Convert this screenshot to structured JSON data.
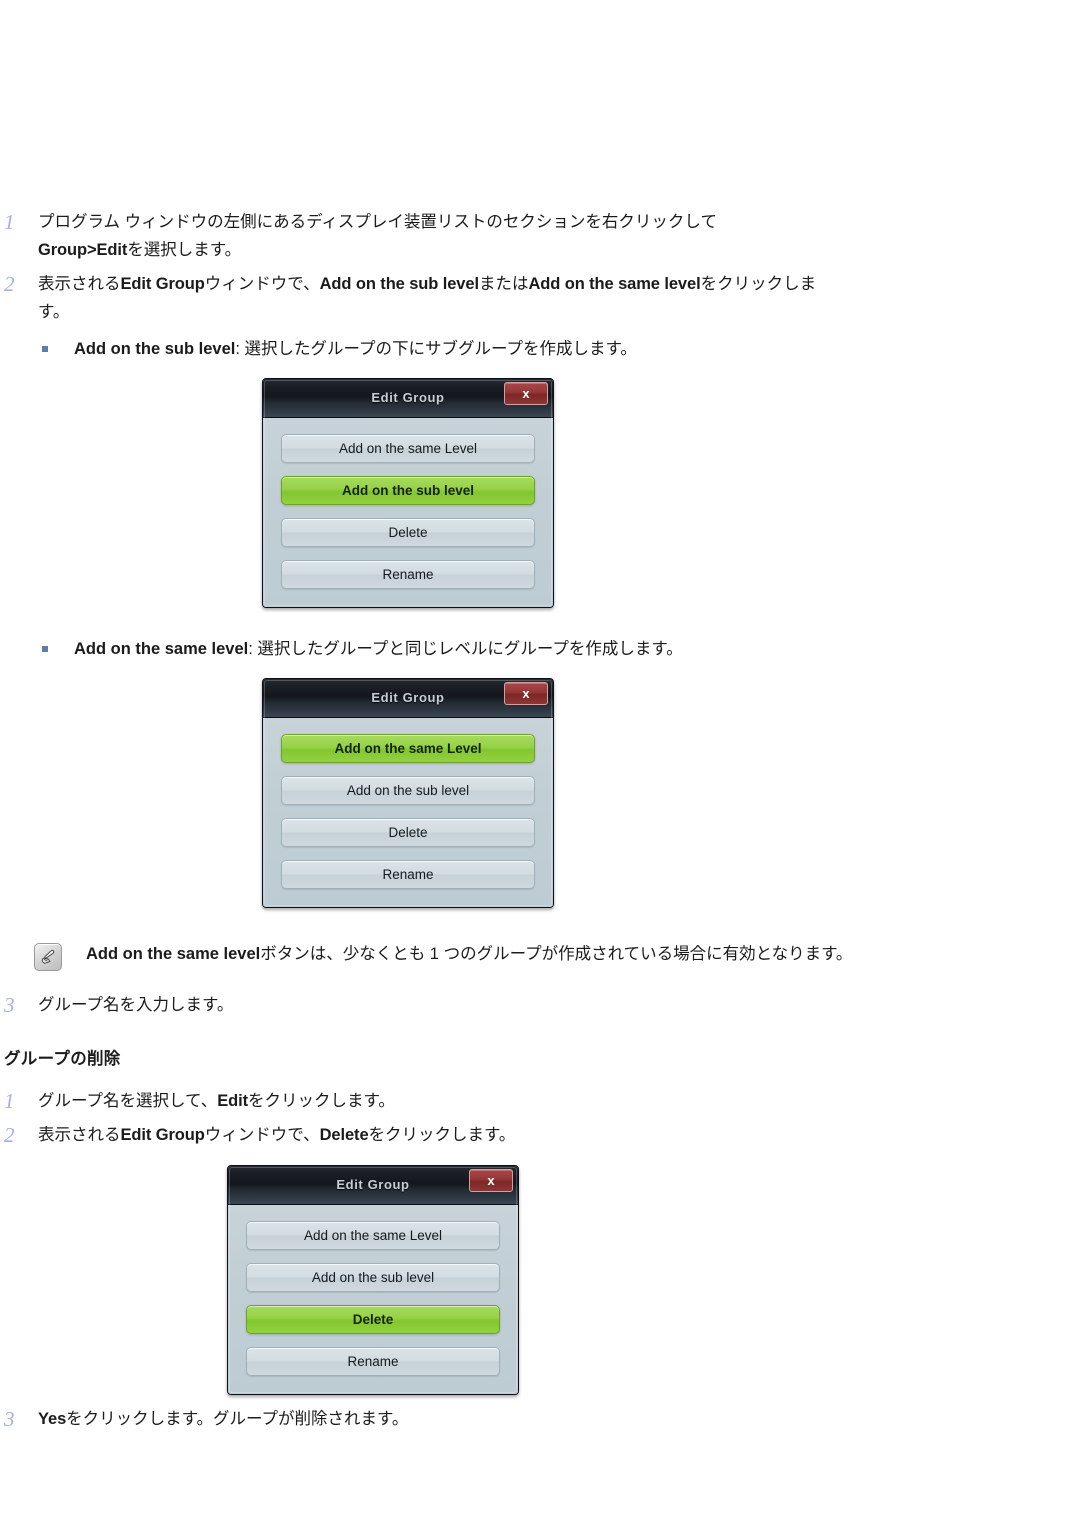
{
  "steps_create": [
    {
      "num": "1",
      "line1_pre": "プログラム ウィンドウの左側にあるディスプレイ装置リストのセクションを右クリックして",
      "line2_bold": "Group>Edit",
      "line2_post": "を選択します。"
    },
    {
      "num": "2",
      "pre": "表示される",
      "b1": "Edit Group",
      "mid1": "ウィンドウで、",
      "b2": "Add on the sub level",
      "mid2": "または",
      "b3": "Add on the same level",
      "post": "をクリックします。"
    },
    {
      "num": "3",
      "text": "グループ名を入力します。"
    }
  ],
  "bullets": [
    {
      "label": "Add on the sub level",
      "desc": ": 選択したグループの下にサブグループを作成します。"
    },
    {
      "label": "Add on the same level",
      "desc": ": 選択したグループと同じレベルにグループを作成します。"
    }
  ],
  "note": {
    "icon": "note-pencil-icon",
    "bold": "Add on the same level",
    "text": "ボタンは、少なくとも 1 つのグループが作成されている場合に有効となります。"
  },
  "section_delete": {
    "heading": "グループの削除",
    "steps": [
      {
        "num": "1",
        "pre": "グループ名を選択して、",
        "bold": "Edit",
        "post": "をクリックします。"
      },
      {
        "num": "2",
        "pre": "表示される",
        "b1": "Edit Group",
        "mid": "ウィンドウで、",
        "b2": "Delete",
        "post": "をクリックします。"
      },
      {
        "num": "3",
        "bold": "Yes",
        "post": "をクリックします。グループが削除されます。"
      }
    ]
  },
  "dialogs": [
    {
      "id": "dialog-sub-level",
      "title": "Edit Group",
      "close_label": "x",
      "buttons": [
        {
          "label": "Add on the same Level",
          "selected": false
        },
        {
          "label": "Add on the sub level",
          "selected": true
        },
        {
          "label": "Delete",
          "selected": false
        },
        {
          "label": "Rename",
          "selected": false
        }
      ]
    },
    {
      "id": "dialog-same-level",
      "title": "Edit Group",
      "close_label": "x",
      "buttons": [
        {
          "label": "Add on the same Level",
          "selected": true
        },
        {
          "label": "Add on the sub level",
          "selected": false
        },
        {
          "label": "Delete",
          "selected": false
        },
        {
          "label": "Rename",
          "selected": false
        }
      ]
    },
    {
      "id": "dialog-delete",
      "title": "Edit Group",
      "close_label": "x",
      "buttons": [
        {
          "label": "Add on the same Level",
          "selected": false
        },
        {
          "label": "Add on the sub level",
          "selected": false
        },
        {
          "label": "Delete",
          "selected": true
        },
        {
          "label": "Rename",
          "selected": false
        }
      ]
    }
  ],
  "colors": {
    "step_number": "#a3b0ea",
    "bullet_marker": "#5c7fa6",
    "dialog_body": "#c3d0d6",
    "dialog_title_bar": "#13171c",
    "button_selected_green": "#8fcf3c",
    "button_normal": "#d2dce1",
    "close_button_red": "#953636",
    "text": "#1b1b1b"
  }
}
